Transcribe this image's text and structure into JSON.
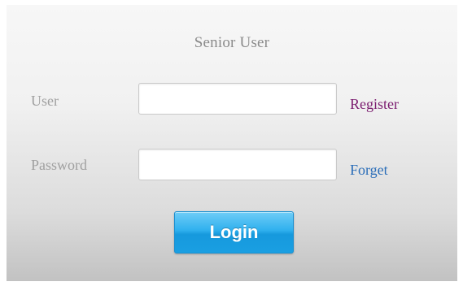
{
  "login_form": {
    "title": "Senior User",
    "user_label": "User",
    "user_value": "",
    "register_link": "Register",
    "password_label": "Password",
    "password_value": "",
    "forget_link": "Forget",
    "login_button": "Login"
  },
  "colors": {
    "register_link": "#7b1c6f",
    "forget_link": "#2a6db8",
    "login_button": "#1a9fe2",
    "label_text": "#a0a0a0"
  }
}
